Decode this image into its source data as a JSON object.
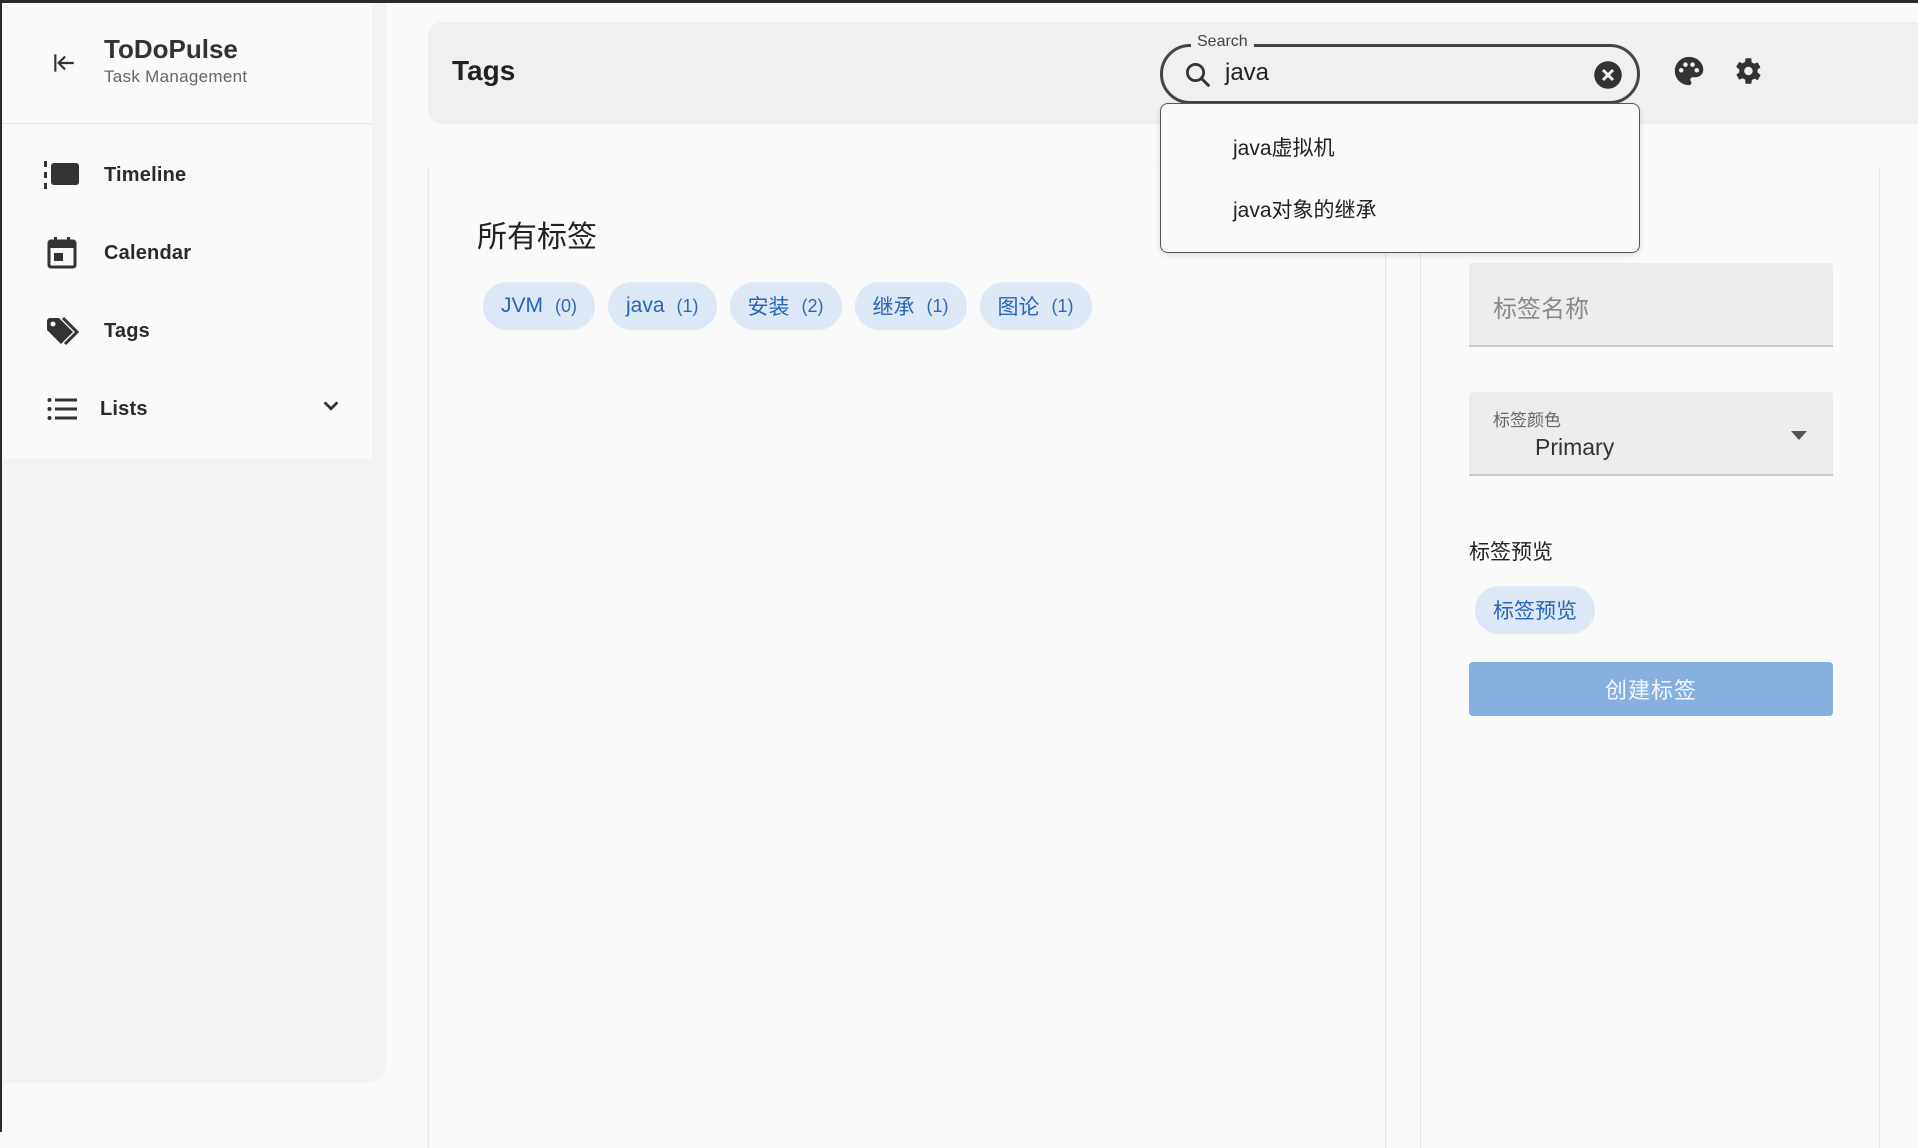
{
  "app": {
    "title": "ToDoPulse",
    "subtitle": "Task Management"
  },
  "sidebar": {
    "items": [
      {
        "label": "Timeline",
        "icon": "timeline-icon"
      },
      {
        "label": "Calendar",
        "icon": "calendar-icon"
      },
      {
        "label": "Tags",
        "icon": "tags-icon"
      },
      {
        "label": "Lists",
        "icon": "list-icon"
      }
    ]
  },
  "header": {
    "title": "Tags"
  },
  "search": {
    "legend": "Search",
    "value": "java",
    "suggestions": [
      "java虚拟机",
      "java对象的继承"
    ]
  },
  "main": {
    "section_title": "所有标签",
    "tags": [
      {
        "name": "JVM",
        "count": "(0)"
      },
      {
        "name": "java",
        "count": "(1)"
      },
      {
        "name": "安装",
        "count": "(2)"
      },
      {
        "name": "继承",
        "count": "(1)"
      },
      {
        "name": "图论",
        "count": "(1)"
      }
    ]
  },
  "form": {
    "name_placeholder": "标签名称",
    "color_label": "标签颜色",
    "color_value": "Primary",
    "preview_label": "标签预览",
    "preview_chip": "标签预览",
    "create_button": "创建标签"
  },
  "colors": {
    "chip_bg": "#dce8f5",
    "chip_text": "#2766b8",
    "create_button_bg": "#86b0e0"
  }
}
